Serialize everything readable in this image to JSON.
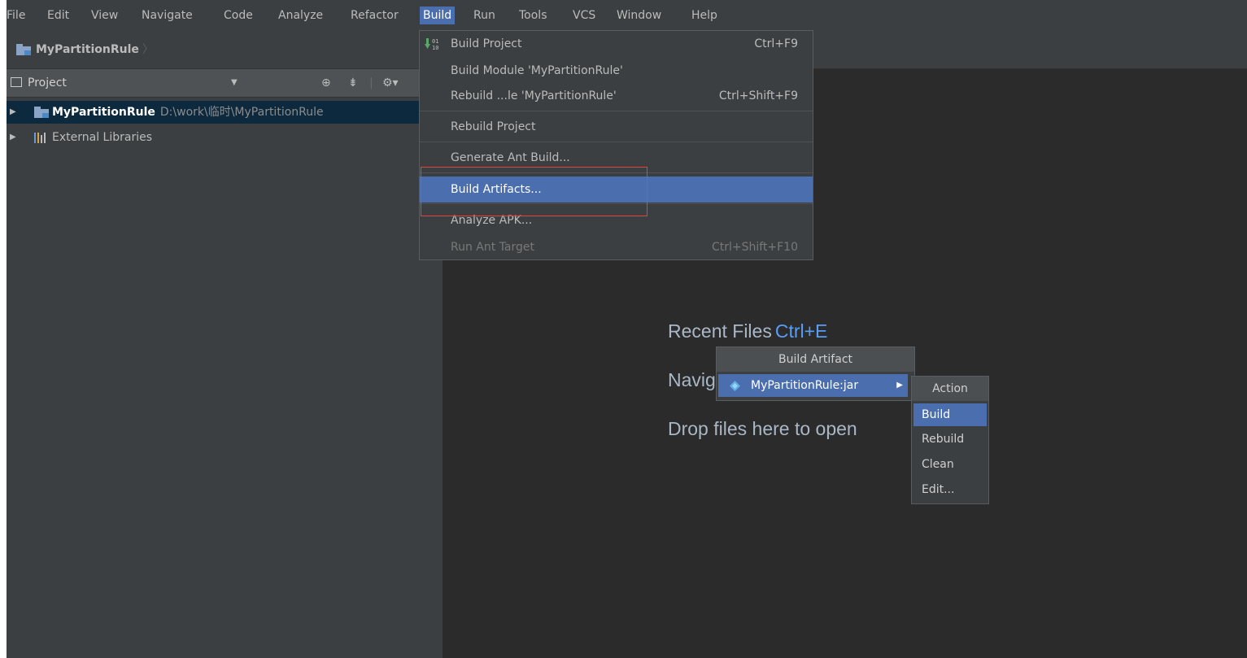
{
  "menubar": {
    "items": [
      "File",
      "Edit",
      "View",
      "Navigate",
      "Code",
      "Analyze",
      "Refactor",
      "Build",
      "Run",
      "Tools",
      "VCS",
      "Window",
      "Help"
    ],
    "active": "Build"
  },
  "breadcrumb": {
    "project": "MyPartitionRule",
    "separator": "〉"
  },
  "project_panel": {
    "title": "Project",
    "tree": [
      {
        "name": "MyPartitionRule",
        "path": "D:\\work\\临时\\MyPartitionRule",
        "icon": "module-folder-icon",
        "selected": true
      },
      {
        "name": "External Libraries",
        "icon": "libraries-icon",
        "selected": false
      }
    ]
  },
  "build_menu": {
    "items": [
      {
        "label": "Build Project",
        "shortcut": "Ctrl+F9",
        "icon": "build-project-icon"
      },
      {
        "label": "Build Module 'MyPartitionRule'",
        "shortcut": ""
      },
      {
        "label": "Rebuild ...le 'MyPartitionRule'",
        "shortcut": "Ctrl+Shift+F9"
      },
      {
        "label": "Rebuild Project",
        "shortcut": ""
      },
      {
        "label": "Generate Ant Build...",
        "shortcut": ""
      },
      {
        "label": "Build Artifacts...",
        "shortcut": "",
        "highlighted": true
      },
      {
        "label": "Analyze APK...",
        "shortcut": ""
      },
      {
        "label": "Run Ant Target",
        "shortcut": "Ctrl+Shift+F10",
        "disabled": true
      }
    ]
  },
  "editor": {
    "recent_files_label": "Recent Files",
    "recent_files_shortcut": "Ctrl+E",
    "navigation_label": "Navig",
    "drop_hint": "Drop files here to open"
  },
  "artifact_popup": {
    "title": "Build Artifact",
    "item": "MyPartitionRule:jar"
  },
  "action_menu": {
    "title": "Action",
    "items": [
      "Build",
      "Rebuild",
      "Clean",
      "Edit..."
    ],
    "selected": "Build"
  },
  "colors": {
    "accent": "#4b6eaf",
    "annotation_box": "#e0463c",
    "shortcut_blue": "#589df6"
  }
}
